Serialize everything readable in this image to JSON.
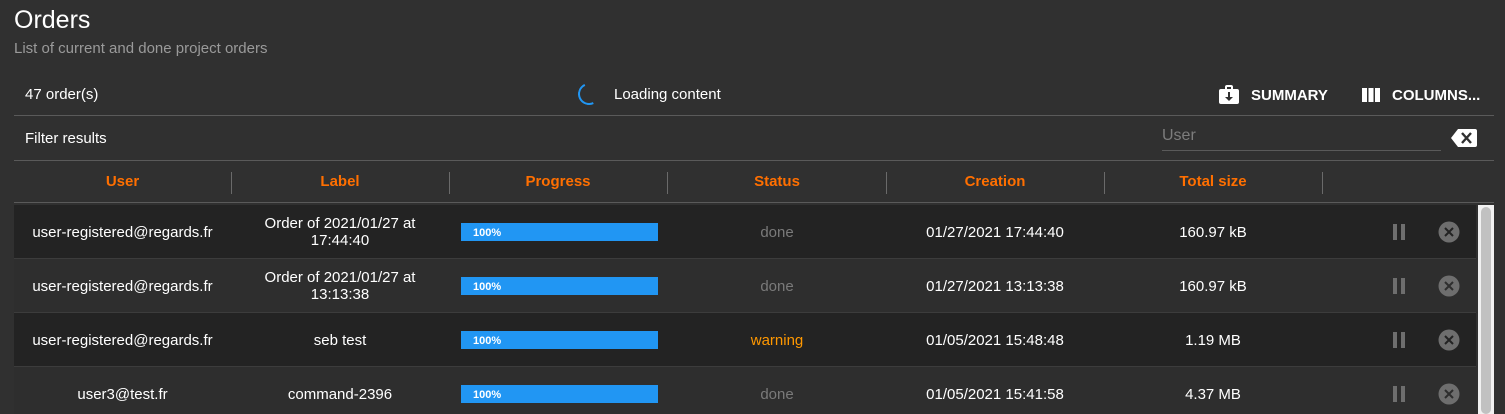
{
  "header": {
    "title": "Orders",
    "subtitle": "List of current and done project orders"
  },
  "toolbar": {
    "count": "47 order(s)",
    "loading_text": "Loading content",
    "summary_label": "SUMMARY",
    "columns_label": "COLUMNS..."
  },
  "filter": {
    "label": "Filter results",
    "user_placeholder": "User"
  },
  "table": {
    "columns": [
      "User",
      "Label",
      "Progress",
      "Status",
      "Creation",
      "Total size"
    ],
    "rows": [
      {
        "user": "user-registered@regards.fr",
        "label": "Order of 2021/01/27 at 17:44:40",
        "progress": "100%",
        "progress_value": 100,
        "status": "done",
        "creation": "01/27/2021 17:44:40",
        "size": "160.97 kB"
      },
      {
        "user": "user-registered@regards.fr",
        "label": "Order of 2021/01/27 at 13:13:38",
        "progress": "100%",
        "progress_value": 100,
        "status": "done",
        "creation": "01/27/2021 13:13:38",
        "size": "160.97 kB"
      },
      {
        "user": "user-registered@regards.fr",
        "label": "seb test",
        "progress": "100%",
        "progress_value": 100,
        "status": "warning",
        "creation": "01/05/2021 15:48:48",
        "size": "1.19 MB"
      },
      {
        "user": "user3@test.fr",
        "label": "command-2396",
        "progress": "100%",
        "progress_value": 100,
        "status": "done",
        "creation": "01/05/2021 15:41:58",
        "size": "4.37 MB"
      }
    ]
  },
  "icons": {
    "summary": "briefcase-download-icon",
    "columns": "view-column-icon",
    "clear": "backspace-icon",
    "pause": "pause-icon",
    "cancel": "cancel-icon"
  },
  "colors": {
    "accent": "#ff6f00",
    "progress": "#2196f3",
    "warning": "#ff9800",
    "done": "#7a7a7a",
    "background": "#303030"
  }
}
